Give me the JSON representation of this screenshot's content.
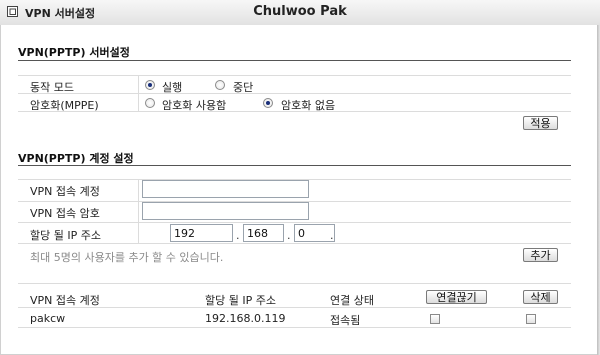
{
  "window": {
    "icon": "window-stack-icon",
    "title": "VPN 서버설정",
    "user": "Chulwoo Pak"
  },
  "server_settings": {
    "section_title": "VPN(PPTP) 서버설정",
    "mode": {
      "label": "동작 모드",
      "options": [
        "실행",
        "중단"
      ],
      "selected": "실행"
    },
    "encryption": {
      "label": "암호화(MPPE)",
      "options": [
        "암호화 사용함",
        "암호화 없음"
      ],
      "selected": "암호화 없음"
    },
    "apply_button": "적용"
  },
  "account_settings": {
    "section_title": "VPN(PPTP) 계정 설정",
    "account_label": "VPN 접속 계정",
    "account_value": "",
    "password_label": "VPN 접속 암호",
    "password_value": "",
    "ip_label": "할당 될 IP 주소",
    "ip_octets": [
      "192",
      "168",
      "0",
      ""
    ],
    "hint": "최대 5명의 사용자를 추가 할 수 있습니다.",
    "add_button": "추가"
  },
  "accounts_table": {
    "headers": {
      "account": "VPN 접속 계정",
      "ip": "할당 될 IP 주소",
      "status": "연결 상태",
      "disconnect": "연결끊기",
      "delete": "삭제"
    },
    "rows": [
      {
        "account": "pakcw",
        "ip": "192.168.0.119",
        "status": "접속됨",
        "disconnect_checked": false,
        "delete_checked": false
      }
    ]
  }
}
